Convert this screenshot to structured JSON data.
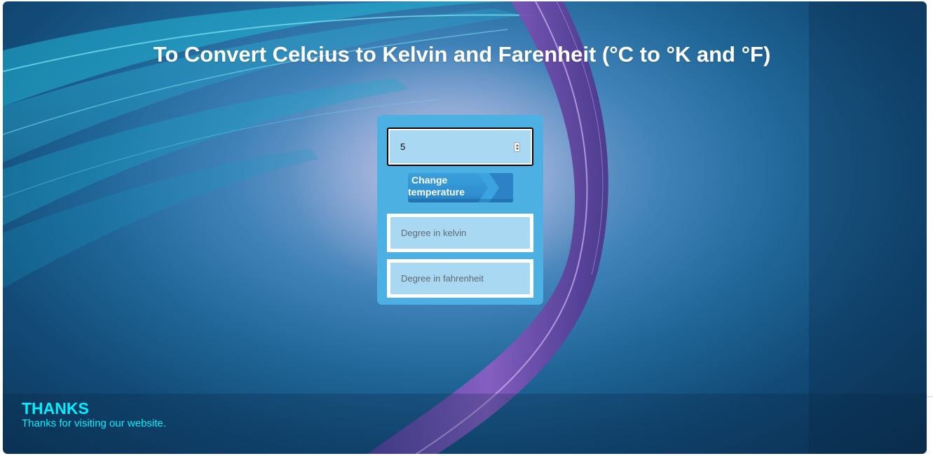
{
  "page": {
    "title": "To Convert Celcius to Kelvin and Farenheit (°C to °K and °F)"
  },
  "converter": {
    "celsius_value": "5",
    "change_button_line1": "Change",
    "change_button_line2": "temperature",
    "kelvin_placeholder": "Degree in kelvin",
    "fahrenheit_placeholder": "Degree in fahrenheit"
  },
  "footer": {
    "heading": "THANKS",
    "message": "Thanks for visiting our website."
  },
  "colors": {
    "panel": "#4db0e2",
    "field": "#a9d8f2",
    "footer_text": "#00f0ff",
    "title_text": "#ffffff"
  },
  "icons": {
    "number_spinner": "spinner-icon",
    "button_arrow": "chevron-right-icon"
  }
}
